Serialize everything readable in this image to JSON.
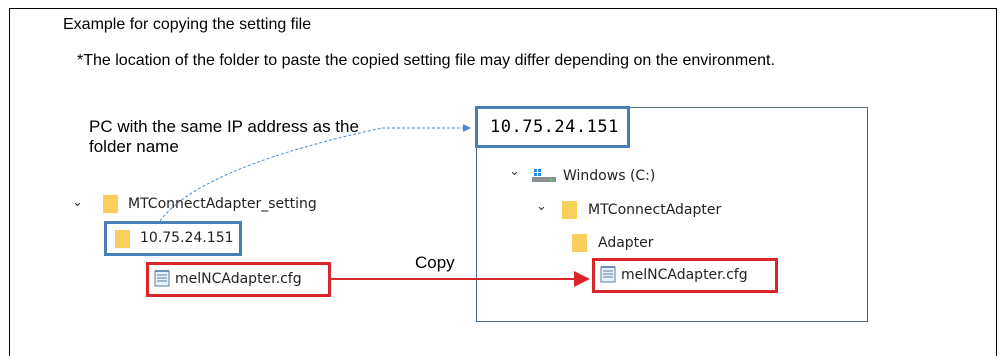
{
  "title": "Example for copying the setting file",
  "note": "*The location of the folder to paste the copied setting file may differ depending on the environment.",
  "pc_label": {
    "line1": "PC with the same IP address as the",
    "line2": "folder name"
  },
  "left_tree": {
    "parent_folder": "MTConnectAdapter_setting",
    "ip_folder": "10.75.24.151",
    "file": "melNCAdapter.cfg"
  },
  "right_panel": {
    "ip_header": "10.75.24.151",
    "drive": "Windows (C:)",
    "folder": "MTConnectAdapter",
    "subfolder": "Adapter",
    "file": "melNCAdapter.cfg"
  },
  "copy_label": "Copy",
  "colors": {
    "blue_box": "#4a7fb5",
    "red_box": "#d9262a",
    "folder": "#f6c94e",
    "dashed_arrow": "#4a8ad0"
  },
  "icons": {
    "chevron": "chevron-down-icon",
    "folder": "folder-icon",
    "drive": "windows-drive-icon",
    "file": "notepad-file-icon"
  }
}
